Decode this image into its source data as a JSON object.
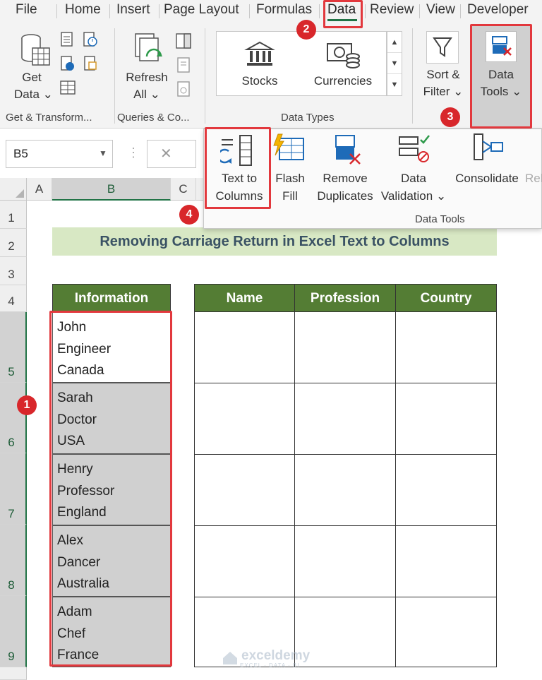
{
  "menu": {
    "tabs": [
      "File",
      "Home",
      "Insert",
      "Page Layout",
      "Formulas",
      "Data",
      "Review",
      "View",
      "Developer"
    ],
    "active": "Data"
  },
  "ribbon": {
    "get_data": {
      "line1": "Get",
      "line2": "Data ⌄"
    },
    "refresh_all": {
      "line1": "Refresh",
      "line2": "All ⌄"
    },
    "stocks": "Stocks",
    "currencies": "Currencies",
    "sort_filter": {
      "line1": "Sort &",
      "line2": "Filter ⌄"
    },
    "data_tools": {
      "line1": "Data",
      "line2": "Tools ⌄"
    },
    "groups": {
      "get_transform": "Get & Transform...",
      "queries": "Queries & Co...",
      "data_types": "Data Types"
    }
  },
  "formula_bar": {
    "name_box": "B5",
    "cancel_symbol": "✕",
    "dots": "⋮"
  },
  "data_tools_panel": {
    "text_to_columns": {
      "line1": "Text to",
      "line2": "Columns"
    },
    "flash_fill": {
      "line1": "Flash",
      "line2": "Fill"
    },
    "remove_duplicates": {
      "line1": "Remove",
      "line2": "Duplicates"
    },
    "data_validation": {
      "line1": "Data",
      "line2": "Validation ⌄"
    },
    "consolidate": "Consolidate",
    "relationships_partial": "Rel",
    "group_label": "Data Tools"
  },
  "sheet": {
    "columns": [
      "A",
      "B",
      "C"
    ],
    "rows": [
      "1",
      "2",
      "3",
      "4",
      "5",
      "6",
      "7",
      "8",
      "9"
    ],
    "title": "Removing Carriage Return in Excel Text to Columns",
    "headers": {
      "information": "Information",
      "name": "Name",
      "profession": "Profession",
      "country": "Country"
    },
    "info": [
      [
        "John",
        "Engineer",
        "Canada"
      ],
      [
        "Sarah",
        "Doctor",
        "USA"
      ],
      [
        "Henry",
        "Professor",
        "England"
      ],
      [
        "Alex",
        "Dancer",
        "Australia"
      ],
      [
        "Adam",
        "Chef",
        "France"
      ]
    ]
  },
  "callouts": [
    "1",
    "2",
    "3",
    "4"
  ],
  "watermark": {
    "brand": "exceldemy",
    "tagline": "EXCEL · DATA · BI"
  },
  "colors": {
    "header_green": "#547d34",
    "title_bg": "#d8e8c4",
    "highlight_red": "#e2383d",
    "excel_green": "#217346"
  }
}
